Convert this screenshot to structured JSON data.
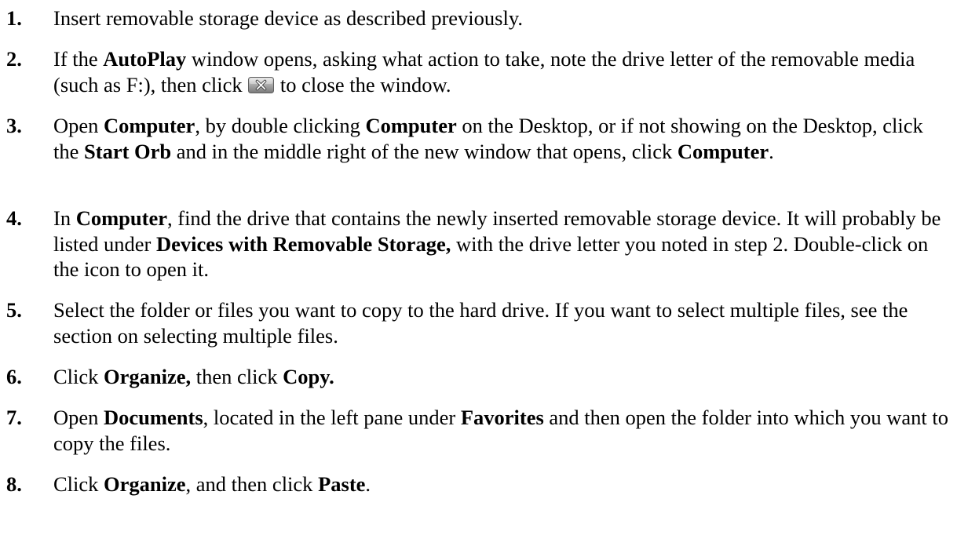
{
  "steps": [
    {
      "number": "1.",
      "parts": [
        "Insert removable storage device as described previously."
      ]
    },
    {
      "number": "2.",
      "parts": [
        "If the ",
        "AutoPlay",
        " window opens, asking what action to take, note the drive letter of the removable media (such as F:), then click ",
        " to close the window."
      ],
      "icon": "close-window-icon"
    },
    {
      "number": "3.",
      "parts": [
        "Open ",
        "Computer",
        ", by double clicking ",
        "Computer",
        " on the Desktop, or if not showing on the Desktop, click the ",
        "Start Orb",
        " and in the middle right of the new window that opens, click ",
        "Computer",
        "."
      ]
    },
    {
      "number": "4.",
      "parts": [
        "In ",
        "Computer",
        ", find the drive that contains the newly inserted removable storage device. It will probably be listed under ",
        "Devices with Removable Storage,",
        " with the drive letter you noted in step 2.  Double-click on the icon to open it."
      ]
    },
    {
      "number": "5.",
      "parts": [
        "Select the folder or files you want to copy to the hard drive.  If you want to select multiple files, see the section on selecting multiple files."
      ]
    },
    {
      "number": "6.",
      "parts": [
        "Click ",
        "Organize,",
        " then click ",
        "Copy."
      ]
    },
    {
      "number": "7.",
      "parts": [
        "Open ",
        "Documents",
        ", located in the left pane under ",
        "Favorites",
        " and then open the folder into which you want to copy the files."
      ]
    },
    {
      "number": "8.",
      "parts": [
        "Click ",
        "Organize",
        ", and then click ",
        "Paste",
        "."
      ]
    }
  ],
  "colors": {
    "text": "#000000",
    "background": "#ffffff",
    "icon_frame": "#6e6e6e",
    "icon_fill": "#b4b4b4"
  }
}
